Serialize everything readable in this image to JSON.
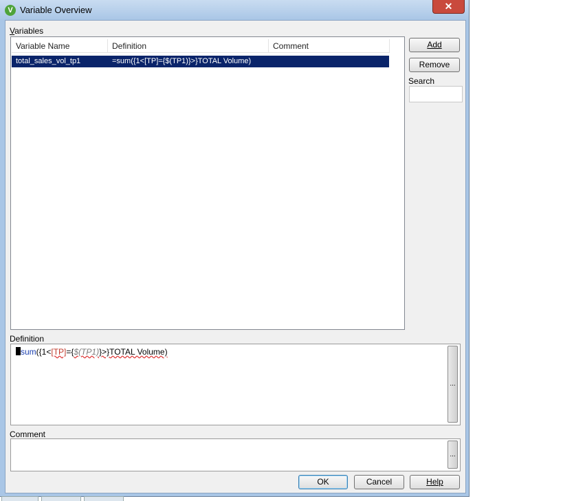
{
  "window": {
    "title": "Variable Overview",
    "app_icon_letter": "V",
    "close_label": "✕"
  },
  "variables_label": "Variables",
  "table": {
    "columns": [
      "Variable Name",
      "Definition",
      "Comment"
    ],
    "rows": [
      {
        "name": "total_sales_vol_tp1",
        "definition": "=sum({1<[TP]={$(TP1)}>}TOTAL Volume)",
        "comment": ""
      }
    ],
    "selected_row_color": "#0a246a"
  },
  "buttons": {
    "add": "Add",
    "remove": "Remove",
    "ok": "OK",
    "cancel": "Cancel",
    "help": "Help"
  },
  "search": {
    "label": "Search",
    "value": ""
  },
  "definition": {
    "label": "Definition",
    "tokens": {
      "eq": "=",
      "fn": "sum",
      "p1": "({1<",
      "field": "[TP]",
      "p2": "={",
      "var": "$(TP1)",
      "p3": "}>}",
      "rest": "TOTAL Volume)"
    },
    "expand_label": "..."
  },
  "comment": {
    "label": "Comment",
    "value": "",
    "expand_label": "..."
  }
}
